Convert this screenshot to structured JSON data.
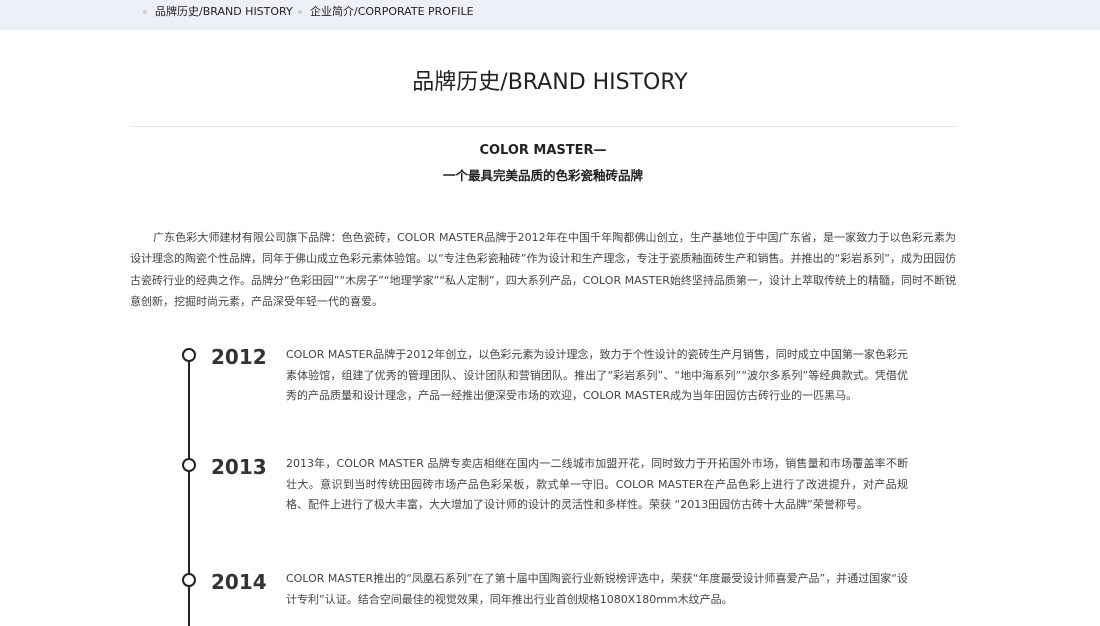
{
  "nav": {
    "tabs": [
      {
        "label": "品牌历史/BRAND HISTORY"
      },
      {
        "label": "企业简介/CORPORATE PROFILE"
      }
    ]
  },
  "page": {
    "title": "品牌历史/BRAND HISTORY",
    "slogan_en": "COLOR MASTER—",
    "slogan_zh": "一个最具完美品质的色彩瓷釉砖品牌",
    "intro": "广东色彩大师建材有限公司旗下品牌：色色瓷砖，COLOR MASTER品牌于2012年在中国千年陶都佛山创立，生产基地位于中国广东省，是一家致力于以色彩元素为设计理念的陶瓷个性品牌，同年于佛山成立色彩元素体验馆。以“专注色彩瓷釉砖”作为设计和生产理念，专注于瓷质釉面砖生产和销售。并推出的“彩岩系列”，成为田园仿古瓷砖行业的经典之作。品牌分“色彩田园”“木房子”“地理学家”“私人定制”，四大系列产品，COLOR MASTER始终坚持品质第一，设计上萃取传统上的精髓，同时不断锐意创新，挖掘时尚元素，产品深受年轻一代的喜爱。"
  },
  "timeline": [
    {
      "year": "2012",
      "text": "COLOR MASTER品牌于2012年创立，以色彩元素为设计理念，致力于个性设计的瓷砖生产月销售，同时成立中国第一家色彩元素体验馆，组建了优秀的管理团队、设计团队和营销团队。推出了“彩岩系列”、“地中海系列”“波尔多系列”等经典款式。凭借优秀的产品质量和设计理念，产品一经推出便深受市场的欢迎，COLOR MASTER成为当年田园仿古砖行业的一匹黑马。"
    },
    {
      "year": "2013",
      "text": "2013年，COLOR MASTER 品牌专卖店相继在国内一二线城市加盟开花，同时致力于开拓国外市场，销售量和市场覆盖率不断壮大。意识到当时传统田园砖市场产品色彩呆板，款式单一守旧。COLOR MASTER在产品色彩上进行了改进提升，对产品规格、配件上进行了极大丰富，大大增加了设计师的设计的灵活性和多样性。荣获 “2013田园仿古砖十大品牌”荣誉称号。"
    },
    {
      "year": "2014",
      "text": "COLOR MASTER推出的“凤凰石系列”在了第十届中国陶瓷行业新锐榜评选中，荣获“年度最受设计师喜爱产品”，并通过国家“设计专利”认证。结合空间最佳的视觉效果，同年推出行业首创规格1080X180mm木纹产品。"
    }
  ]
}
